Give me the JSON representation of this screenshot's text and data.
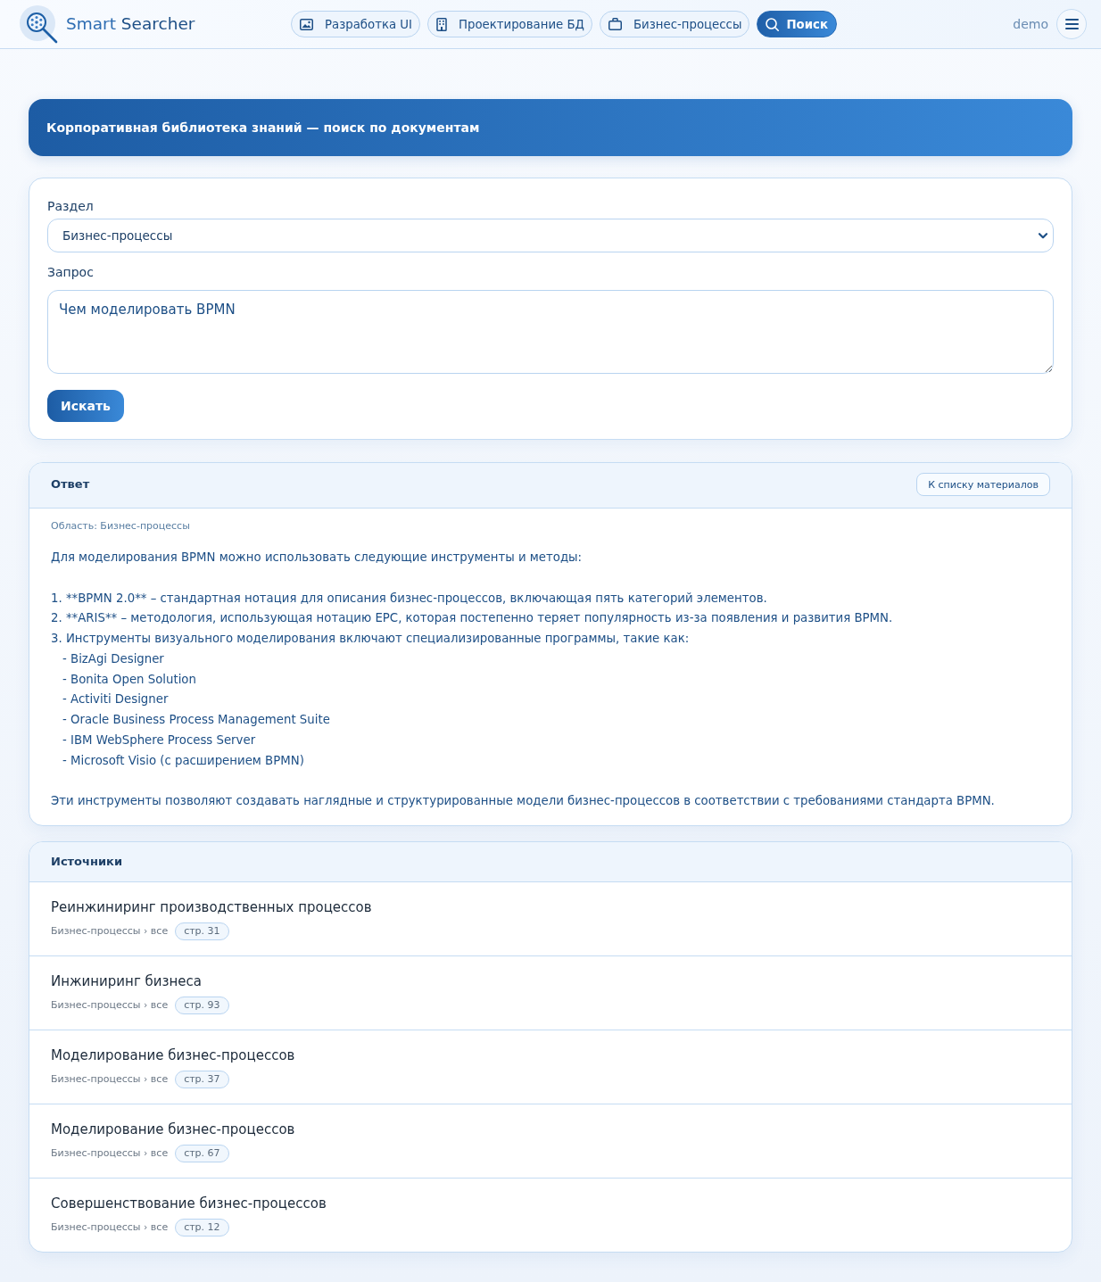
{
  "header": {
    "logo_words": [
      "Smart",
      "Searcher"
    ],
    "nav": [
      {
        "label": "Разработка UI",
        "selected": false
      },
      {
        "label": "Проектирование БД",
        "selected": false
      },
      {
        "label": "Бизнес-процессы",
        "selected": false
      },
      {
        "label": "Поиск",
        "selected": true
      }
    ],
    "user": "demo"
  },
  "banner": {
    "title": "Корпоративная библиотека знаний — поиск по документам"
  },
  "search_form": {
    "section_label": "Раздел",
    "section_value": "Бизнес-процессы",
    "query_label": "Запрос",
    "query_value": "Чем моделировать BPMN",
    "submit": "Искать"
  },
  "answer": {
    "title": "Ответ",
    "back_button": "К списку материалов",
    "scope": "Область: Бизнес-процессы",
    "intro": "Для моделирования BPMN можно использовать следующие инструменты и методы:",
    "items": [
      {
        "text": "1. **BPMN 2.0** – стандартная нотация для описания бизнес-процессов, включающая пять категорий элементов."
      },
      {
        "text": "2. **ARIS** – методология, использующая нотацию EPC, которая постепенно теряет популярность из-за появления и развития BPMN."
      },
      {
        "text": "3. Инструменты визуального моделирования включают специализированные программы, такие как:",
        "children": [
          {
            "text": "- BizAgi Designer"
          },
          {
            "text": "- Bonita Open Solution"
          },
          {
            "text": "- Activiti Designer"
          },
          {
            "text": "- Oracle Business Process Management Suite"
          },
          {
            "text": "- IBM WebSphere Process Server"
          },
          {
            "text": "- Microsoft Visio (с расширением BPMN)"
          }
        ]
      }
    ],
    "conclusion": "Эти инструменты позволяют создавать наглядные и структурированные модели бизнес-процессов в соответствии с требованиями стандарта BPMN."
  },
  "sources": {
    "title": "Источники",
    "items": [
      {
        "title": "Реинжиниринг производственных процессов",
        "path": "Бизнес-процессы › все",
        "page": "стр. 31"
      },
      {
        "title": "Инжиниринг бизнеса",
        "path": "Бизнес-процессы › все",
        "page": "стр. 93"
      },
      {
        "title": "Моделирование бизнес-процессов",
        "path": "Бизнес-процессы › все",
        "page": "стр. 37"
      },
      {
        "title": "Моделирование бизнес-процессов",
        "path": "Бизнес-процессы › все",
        "page": "стр. 67"
      },
      {
        "title": "Совершенствование бизнес-процессов",
        "path": "Бизнес-процессы › все",
        "page": "стр. 12"
      }
    ]
  }
}
